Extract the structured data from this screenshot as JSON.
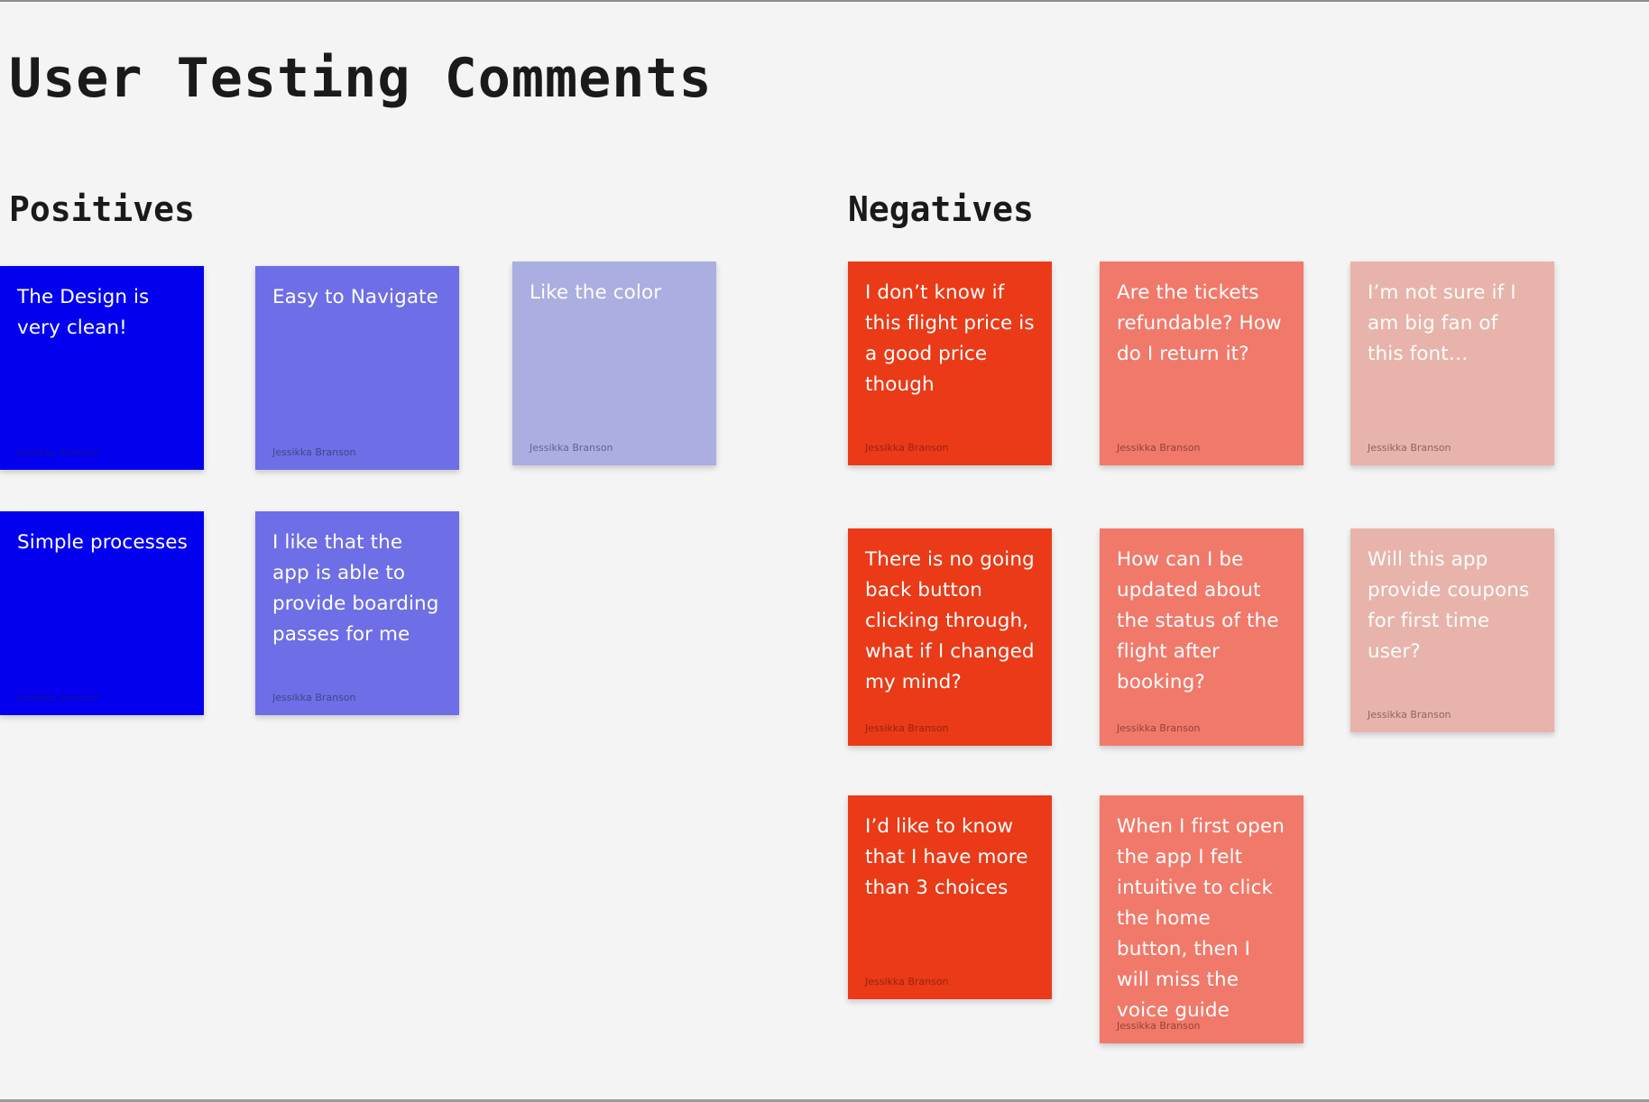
{
  "page": {
    "title": "User Testing Comments"
  },
  "sections": {
    "positives": {
      "title": "Positives"
    },
    "negatives": {
      "title": "Negatives"
    }
  },
  "author": "Jessikka Branson",
  "colors": {
    "blue": "#0300ef",
    "violet": "#6e6ee6",
    "lavender": "#abaee0",
    "red": "#ea3a17",
    "salmon": "#f1796a",
    "pink": "#e8b3aa",
    "background": "#f4f4f4"
  },
  "notes": {
    "positives": [
      {
        "text": "The Design is very clean!",
        "author": "Jessikka Branson"
      },
      {
        "text": "Easy to Navigate",
        "author": "Jessikka Branson"
      },
      {
        "text": "Like the color",
        "author": "Jessikka Branson"
      },
      {
        "text": "Simple processes",
        "author": "Jessikka Branson"
      },
      {
        "text": "I like that the app is able to provide boarding passes for me",
        "author": "Jessikka Branson"
      }
    ],
    "negatives": [
      {
        "text": "I don’t know if this flight price is a good price though",
        "author": "Jessikka Branson"
      },
      {
        "text": "Are the tickets refundable? How do I return it?",
        "author": "Jessikka Branson"
      },
      {
        "text": "I’m not sure if I am big fan of this font…",
        "author": "Jessikka Branson"
      },
      {
        "text": "There is no going back button clicking through, what if I changed my mind?",
        "author": "Jessikka Branson"
      },
      {
        "text": "How can I be updated about the status of the flight after booking?",
        "author": "Jessikka Branson"
      },
      {
        "text": "Will this app provide coupons for first time user?",
        "author": "Jessikka Branson"
      },
      {
        "text": "I’d like to know that I have more than 3 choices",
        "author": "Jessikka Branson"
      },
      {
        "text": "When I first open the app I felt intuitive to click the home button, then I will miss the voice guide",
        "author": "Jessikka Branson"
      }
    ]
  }
}
